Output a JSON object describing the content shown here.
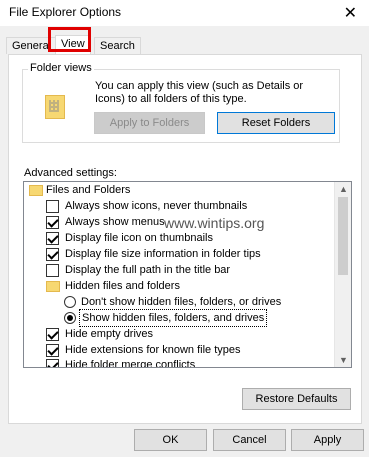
{
  "window": {
    "title": "File Explorer Options",
    "close_glyph": "✕"
  },
  "tabs": [
    {
      "label": "General"
    },
    {
      "label": "View"
    },
    {
      "label": "Search"
    }
  ],
  "folder_views": {
    "label": "Folder views",
    "description": "You can apply this view (such as Details or Icons) to all folders of this type.",
    "apply_button": "Apply to Folders",
    "reset_button": "Reset Folders"
  },
  "advanced": {
    "label": "Advanced settings:",
    "items": [
      {
        "label": "Files and Folders"
      },
      {
        "label": "Always show icons, never thumbnails"
      },
      {
        "label": "Always show menus"
      },
      {
        "label": "Display file icon on thumbnails"
      },
      {
        "label": "Display file size information in folder tips"
      },
      {
        "label": "Display the full path in the title bar"
      },
      {
        "label": "Hidden files and folders"
      },
      {
        "label": "Don't show hidden files, folders, or drives"
      },
      {
        "label": "Show hidden files, folders, and drives"
      },
      {
        "label": "Hide empty drives"
      },
      {
        "label": "Hide extensions for known file types"
      },
      {
        "label": "Hide folder merge conflicts"
      }
    ],
    "watermark": "www.wintips.org"
  },
  "buttons": {
    "restore_defaults": "Restore Defaults",
    "ok": "OK",
    "cancel": "Cancel",
    "apply": "Apply"
  },
  "accent_color": "#e00000"
}
